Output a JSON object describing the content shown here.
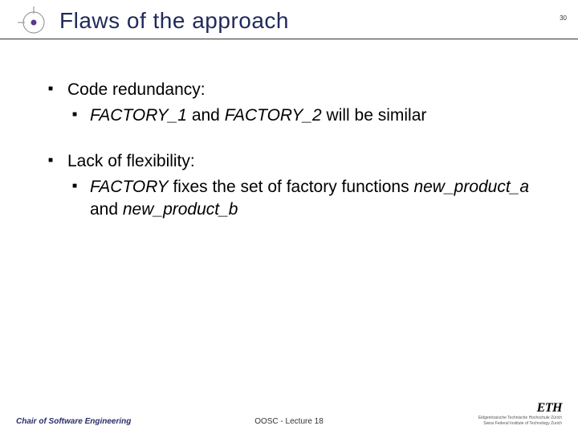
{
  "header": {
    "title": "Flaws of the approach",
    "page_number": "30"
  },
  "bullets": [
    {
      "label": "Code redundancy",
      "suffix": ":",
      "sub": [
        {
          "parts": [
            {
              "text": "FACTORY_1",
              "italic": true
            },
            {
              "text": " and ",
              "italic": false
            },
            {
              "text": "FACTORY_2",
              "italic": true
            },
            {
              "text": " will be similar",
              "italic": false
            }
          ]
        }
      ]
    },
    {
      "label": "Lack of flexibility",
      "suffix": ":",
      "sub": [
        {
          "parts": [
            {
              "text": "FACTORY",
              "italic": true
            },
            {
              "text": " fixes the set of factory functions ",
              "italic": false
            },
            {
              "text": "new_product_a",
              "italic": true
            },
            {
              "text": " and ",
              "italic": false
            },
            {
              "text": "new_product_b",
              "italic": true
            }
          ]
        }
      ]
    }
  ],
  "footer": {
    "left": "Chair of Software Engineering",
    "center": "OOSC - Lecture 18",
    "eth": "ETH",
    "eth_sub1": "Eidgenössische Technische Hochschule Zürich",
    "eth_sub2": "Swiss Federal Institute of Technology Zurich"
  }
}
